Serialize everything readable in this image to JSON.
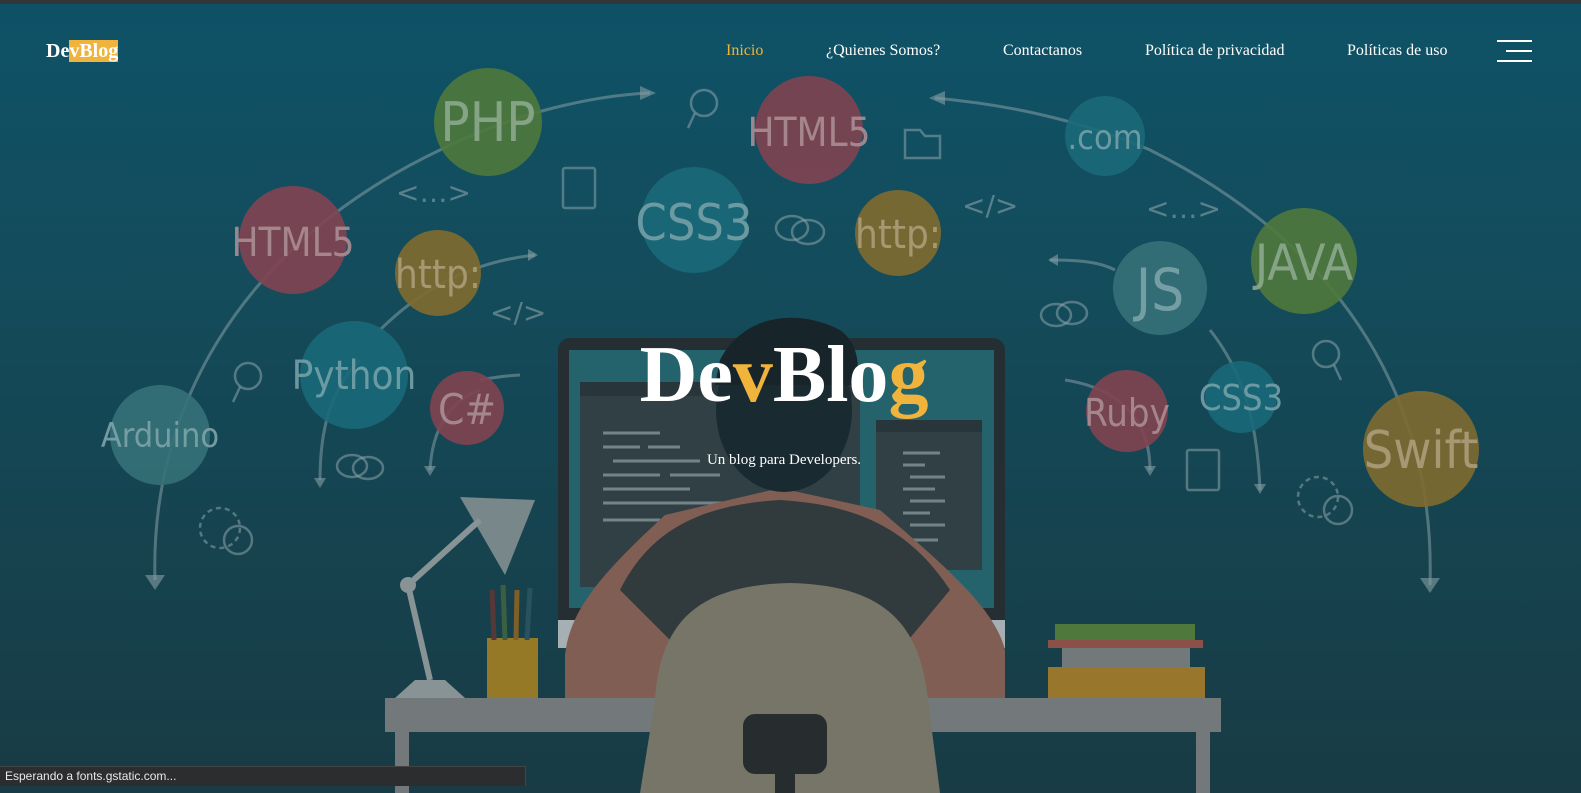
{
  "brand": {
    "part1": "De",
    "part2": "vBlog"
  },
  "nav": [
    {
      "label": "Inicio",
      "active": true
    },
    {
      "label": "¿Quienes Somos?",
      "active": false
    },
    {
      "label": "Contactanos",
      "active": false
    },
    {
      "label": "Política de privacidad",
      "active": false
    },
    {
      "label": "Políticas de uso",
      "active": false
    }
  ],
  "hero": {
    "title_a": "De",
    "title_b": "v",
    "title_c": "Blo",
    "title_d": "g",
    "subtitle": "Un blog para Developers."
  },
  "bubbles": [
    "PHP",
    "HTML5",
    "HTML5",
    ".com",
    "JAVA",
    "CSS3",
    "http:",
    "http:",
    "Python",
    "Arduino",
    "C#",
    "JS",
    "Ruby",
    "CSS3",
    "Swift"
  ],
  "status_text": "Esperando a fonts.gstatic.com...",
  "colors": {
    "accent": "#f0b43c",
    "bg_top": "#0f5a72",
    "bg_bottom": "#1b3f48"
  }
}
